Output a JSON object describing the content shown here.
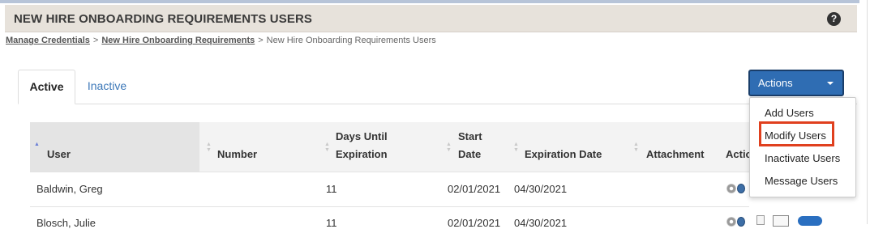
{
  "header": {
    "title": "NEW HIRE ONBOARDING REQUIREMENTS USERS",
    "help_icon": "question-circle-icon",
    "help_glyph": "?"
  },
  "breadcrumb": {
    "items": [
      "Manage Credentials",
      "New Hire Onboarding Requirements",
      "New Hire Onboarding Requirements Users"
    ],
    "separator": ">"
  },
  "tabs": [
    {
      "label": "Active",
      "selected": true
    },
    {
      "label": "Inactive",
      "selected": false
    }
  ],
  "actions": {
    "label": "Actions",
    "menu": [
      "Add Users",
      "Modify Users",
      "Inactivate Users",
      "Message Users"
    ],
    "highlighted": "Modify Users",
    "highlight_color": "#e0401e"
  },
  "table": {
    "columns": {
      "user": "User",
      "number": "Number",
      "days_line1": "Days Until",
      "days_line2": "Expiration",
      "start_line1": "Start",
      "start_line2": "Date",
      "expiration": "Expiration Date",
      "attachment": "Attachment",
      "actions": "Actio"
    },
    "sorted_column": "User",
    "rows": [
      {
        "user": "Baldwin, Greg",
        "number": "",
        "days": "11",
        "start": "02/01/2021",
        "expiration": "04/30/2021",
        "attachment": ""
      },
      {
        "user": "Blosch, Julie",
        "number": "",
        "days": "11",
        "start": "02/01/2021",
        "expiration": "04/30/2021",
        "attachment": ""
      }
    ]
  },
  "colors": {
    "primary_button": "#2f6db3",
    "header_bg": "#e7e2db",
    "link": "#3b77b8"
  }
}
